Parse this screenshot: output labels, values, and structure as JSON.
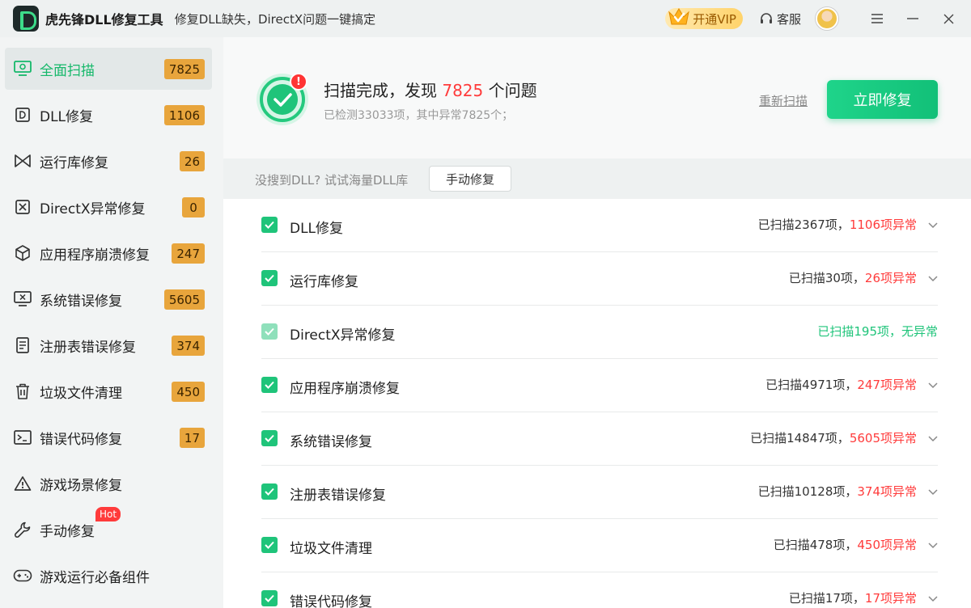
{
  "app": {
    "name": "虎先锋DLL修复工具",
    "tagline": "修复DLL缺失，DirectX问题一键搞定"
  },
  "titlebar": {
    "vip_label": "开通VIP",
    "service_label": "客服"
  },
  "sidebar": {
    "items": [
      {
        "label": "全面扫描",
        "badge": "7825",
        "icon": "monitor-scan-icon"
      },
      {
        "label": "DLL修复",
        "badge": "1106",
        "icon": "dll-icon"
      },
      {
        "label": "运行库修复",
        "badge": "26",
        "icon": "bowtie-icon"
      },
      {
        "label": "DirectX异常修复",
        "badge": "0",
        "icon": "directx-icon"
      },
      {
        "label": "应用程序崩溃修复",
        "badge": "247",
        "icon": "cube-icon"
      },
      {
        "label": "系统错误修复",
        "badge": "5605",
        "icon": "monitor-x-icon"
      },
      {
        "label": "注册表错误修复",
        "badge": "374",
        "icon": "document-icon"
      },
      {
        "label": "垃圾文件清理",
        "badge": "450",
        "icon": "trash-icon"
      },
      {
        "label": "错误代码修复",
        "badge": "17",
        "icon": "terminal-icon"
      },
      {
        "label": "游戏场景修复",
        "badge": "",
        "icon": "warning-icon"
      },
      {
        "label": "手动修复",
        "badge": "",
        "hot": "Hot",
        "icon": "wrench-icon"
      },
      {
        "label": "游戏运行必备组件",
        "badge": "",
        "icon": "gamepad-icon"
      }
    ]
  },
  "summary": {
    "title_prefix": "扫描完成，发现",
    "count": "7825",
    "title_suffix": "个问题",
    "subtitle": "已检测33033项，其中异常7825个；",
    "rescan_label": "重新扫描",
    "fix_now_label": "立即修复",
    "alert_mark": "!"
  },
  "dll_strip": {
    "hint": "没搜到DLL? 试试海量DLL库",
    "manual_button": "手动修复"
  },
  "results": [
    {
      "label": "DLL修复",
      "scanned": "已扫描2367项，",
      "abnormal": "1106项异常",
      "ok": false
    },
    {
      "label": "运行库修复",
      "scanned": "已扫描30项，",
      "abnormal": "26项异常",
      "ok": false
    },
    {
      "label": "DirectX异常修复",
      "scanned": "已扫描195项，无异常",
      "abnormal": "",
      "ok": true
    },
    {
      "label": "应用程序崩溃修复",
      "scanned": "已扫描4971项，",
      "abnormal": "247项异常",
      "ok": false
    },
    {
      "label": "系统错误修复",
      "scanned": "已扫描14847项，",
      "abnormal": "5605项异常",
      "ok": false
    },
    {
      "label": "注册表错误修复",
      "scanned": "已扫描10128项，",
      "abnormal": "374项异常",
      "ok": false
    },
    {
      "label": "垃圾文件清理",
      "scanned": "已扫描478项，",
      "abnormal": "450项异常",
      "ok": false
    },
    {
      "label": "错误代码修复",
      "scanned": "已扫描17项，",
      "abnormal": "17项异常",
      "ok": false
    }
  ],
  "colors": {
    "accent": "#1fc47a",
    "error": "#ff3b3b",
    "badge": "#e8a53c"
  }
}
